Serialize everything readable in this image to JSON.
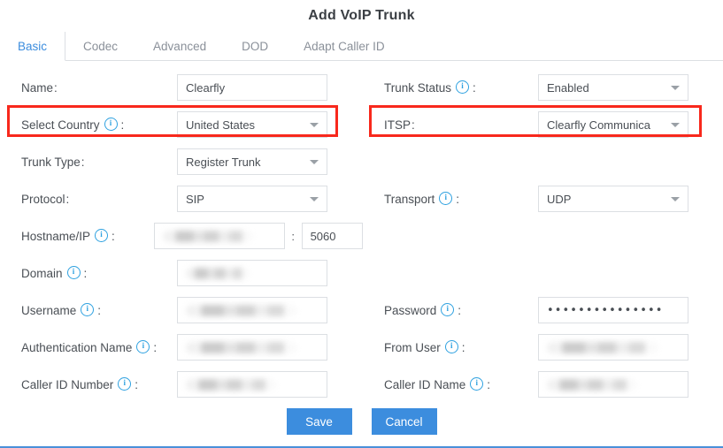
{
  "dialog": {
    "title": "Add VoIP Trunk"
  },
  "tabs": [
    {
      "label": "Basic",
      "active": true
    },
    {
      "label": "Codec",
      "active": false
    },
    {
      "label": "Advanced",
      "active": false
    },
    {
      "label": "DOD",
      "active": false
    },
    {
      "label": "Adapt Caller ID",
      "active": false
    }
  ],
  "form": {
    "name": {
      "label": "Name",
      "colon": ":",
      "info": false,
      "value": "Clearfly",
      "type": "text"
    },
    "trunk_status": {
      "label": "Trunk Status",
      "colon": ":",
      "info": true,
      "value": "Enabled",
      "type": "select"
    },
    "select_country": {
      "label": "Select Country",
      "colon": ":",
      "info": true,
      "value": "United States",
      "type": "select",
      "highlighted": true
    },
    "itsp": {
      "label": "ITSP",
      "colon": ":",
      "info": false,
      "value": "Clearfly Communica",
      "type": "select",
      "highlighted": true
    },
    "trunk_type": {
      "label": "Trunk Type",
      "colon": ":",
      "info": false,
      "value": "Register Trunk",
      "type": "select"
    },
    "protocol": {
      "label": "Protocol",
      "colon": ":",
      "info": false,
      "value": "SIP",
      "type": "select"
    },
    "transport": {
      "label": "Transport",
      "colon": ":",
      "info": true,
      "value": "UDP",
      "type": "select"
    },
    "hostname_ip": {
      "label": "Hostname/IP",
      "colon": ":",
      "info": true,
      "value": "",
      "redacted": true,
      "type": "text"
    },
    "port_separator": ":",
    "port": {
      "value": "5060",
      "type": "text"
    },
    "domain": {
      "label": "Domain",
      "colon": ":",
      "info": true,
      "value": "",
      "redacted": true,
      "type": "text"
    },
    "username": {
      "label": "Username",
      "colon": ":",
      "info": true,
      "value": "",
      "redacted": true,
      "type": "text"
    },
    "password": {
      "label": "Password",
      "colon": ":",
      "info": true,
      "value": "•••••••••••••••",
      "type": "password"
    },
    "authentication_name": {
      "label": "Authentication Name",
      "colon": ":",
      "info": true,
      "value": "",
      "redacted": true,
      "type": "text"
    },
    "from_user": {
      "label": "From User",
      "colon": ":",
      "info": true,
      "value": "",
      "redacted": true,
      "type": "text"
    },
    "caller_id_number": {
      "label": "Caller ID Number",
      "colon": ":",
      "info": true,
      "value": "",
      "redacted": true,
      "type": "text"
    },
    "caller_id_name": {
      "label": "Caller ID Name",
      "colon": ":",
      "info": true,
      "value": "",
      "redacted": true,
      "type": "text"
    }
  },
  "footer": {
    "save_label": "Save",
    "cancel_label": "Cancel"
  },
  "colors": {
    "accent_blue": "#3c8dde",
    "highlight_red": "#f8281c",
    "info_icon_blue": "#2ea1e0",
    "border_gray": "#dcdfe3"
  },
  "icons": {
    "info": "i",
    "caret": "▼"
  }
}
